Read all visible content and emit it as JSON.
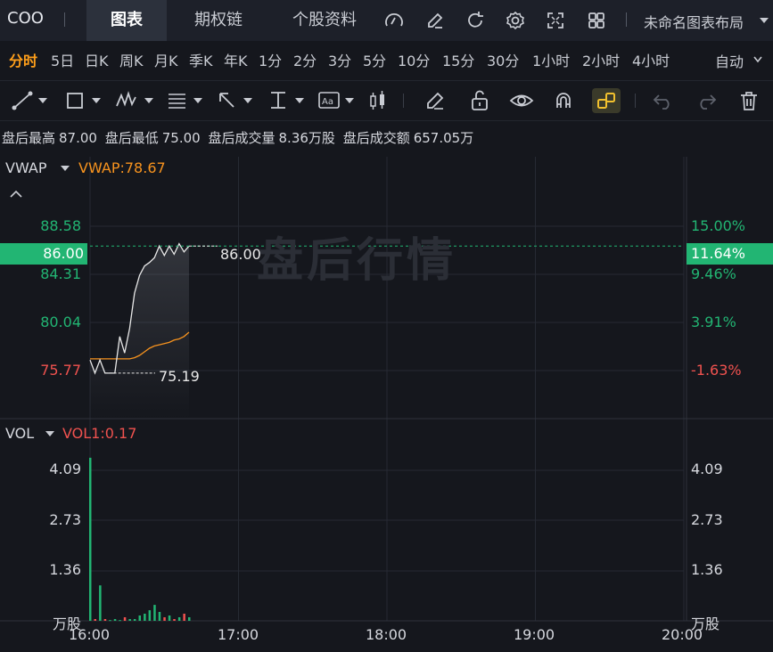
{
  "header": {
    "symbol": "COO",
    "tabs": [
      {
        "label": "图表",
        "active": true
      },
      {
        "label": "期权链",
        "active": false
      },
      {
        "label": "个股资料",
        "active": false
      }
    ],
    "icons": [
      "indicator-icon",
      "draw-icon",
      "refresh-icon",
      "settings-icon",
      "fullscreen-icon",
      "layout-grid-icon"
    ],
    "layout_name": "未命名图表布局"
  },
  "periods": {
    "items": [
      "分时",
      "5日",
      "日K",
      "周K",
      "月K",
      "季K",
      "年K",
      "1分",
      "2分",
      "3分",
      "5分",
      "10分",
      "15分",
      "30分",
      "1小时",
      "2小时",
      "4小时"
    ],
    "active": "分时",
    "auto_label": "自动"
  },
  "stats": {
    "high_label": "盘后最高",
    "high_value": "87.00",
    "low_label": "盘后最低",
    "low_value": "75.00",
    "volume_label": "盘后成交量",
    "volume_value": "8.36万股",
    "turnover_label": "盘后成交额",
    "turnover_value": "657.05万"
  },
  "price_panel": {
    "indicator_name": "VWAP",
    "indicator_value": "VWAP:78.67",
    "current_price": "86.00",
    "current_pct": "11.64%",
    "left_ticks": [
      "88.58",
      "84.31",
      "80.04",
      "75.77"
    ],
    "right_ticks": [
      "15.00%",
      "9.46%",
      "3.91%",
      "-1.63%"
    ],
    "high_marker": "86.00",
    "low_marker": "75.19",
    "watermark": "盘后行情",
    "colors": {
      "up": "#22b573",
      "down": "#f0524f",
      "vwap": "#f7931e",
      "price": "#e8e8e8"
    }
  },
  "volume_panel": {
    "indicator_name": "VOL",
    "indicator_value": "VOL1:0.17",
    "ticks": [
      "4.09",
      "2.73",
      "1.36"
    ],
    "unit": "万股"
  },
  "time_axis": [
    "16:00",
    "17:00",
    "18:00",
    "19:00",
    "20:00"
  ],
  "chart_data": {
    "type": "line",
    "x_range": [
      "16:00",
      "20:00"
    ],
    "ylim": [
      74.5,
      89.5
    ],
    "series": [
      {
        "name": "VWAP",
        "x": [
          "16:00",
          "16:02",
          "16:04",
          "16:06",
          "16:08",
          "16:10",
          "16:12",
          "16:14",
          "16:16",
          "16:18",
          "16:20",
          "16:22",
          "16:24",
          "16:26",
          "16:28",
          "16:30",
          "16:32",
          "16:34",
          "16:36",
          "16:38",
          "16:40"
        ],
        "values": [
          76.4,
          76.4,
          76.4,
          76.4,
          76.4,
          76.4,
          76.4,
          76.4,
          76.4,
          76.5,
          76.7,
          77.0,
          77.3,
          77.5,
          77.6,
          77.7,
          77.8,
          78.0,
          78.1,
          78.3,
          78.67
        ]
      },
      {
        "name": "price",
        "x": [
          "16:00",
          "16:02",
          "16:04",
          "16:06",
          "16:08",
          "16:10",
          "16:12",
          "16:14",
          "16:16",
          "16:18",
          "16:20",
          "16:22",
          "16:24",
          "16:26",
          "16:28",
          "16:30",
          "16:32",
          "16:34",
          "16:36",
          "16:38",
          "16:40"
        ],
        "values": [
          76.3,
          75.19,
          76.3,
          75.19,
          75.19,
          75.19,
          78.3,
          76.9,
          79.0,
          82.0,
          83.5,
          84.3,
          84.6,
          85.0,
          86.0,
          85.2,
          86.0,
          85.3,
          86.2,
          85.5,
          86.0
        ]
      }
    ],
    "volume": {
      "x": [
        "16:00",
        "16:02",
        "16:04",
        "16:06",
        "16:08",
        "16:10",
        "16:12",
        "16:14",
        "16:16",
        "16:18",
        "16:20",
        "16:22",
        "16:24",
        "16:26",
        "16:28",
        "16:30",
        "16:32",
        "16:34",
        "16:36",
        "16:38",
        "16:40"
      ],
      "values": [
        4.6,
        0.05,
        1.0,
        0.05,
        0.02,
        0.05,
        0.02,
        0.1,
        0.05,
        0.05,
        0.15,
        0.2,
        0.3,
        0.45,
        0.25,
        0.1,
        0.15,
        0.05,
        0.1,
        0.2,
        0.1
      ],
      "ylim": [
        0,
        5.0
      ]
    }
  }
}
